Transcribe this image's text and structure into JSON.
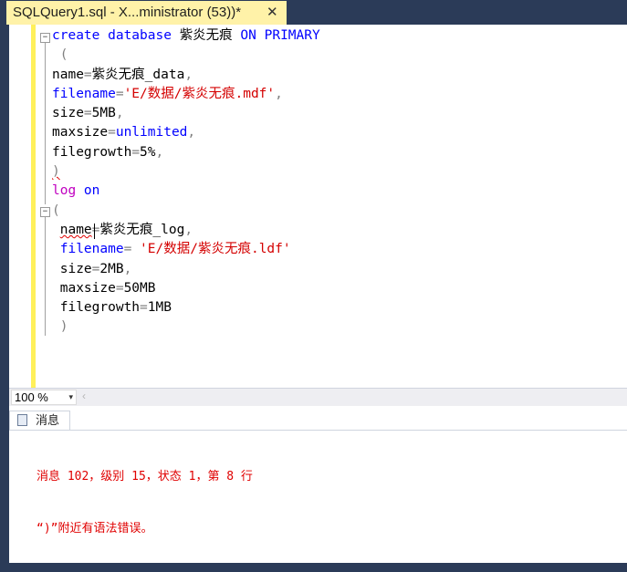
{
  "tab": {
    "title": "SQLQuery1.sql - X...ministrator (53))*",
    "close_glyph": "✕"
  },
  "editor": {
    "lines": [
      [
        {
          "t": "create database ",
          "c": "kw"
        },
        {
          "t": "紫炎无痕 ",
          "c": ""
        },
        {
          "t": "ON PRIMARY",
          "c": "kw"
        }
      ],
      [
        {
          "t": " (",
          "c": "gray"
        }
      ],
      [
        {
          "t": "name",
          "c": ""
        },
        {
          "t": "=",
          "c": "gray"
        },
        {
          "t": "紫炎无痕_data",
          "c": ""
        },
        {
          "t": ",",
          "c": "gray"
        }
      ],
      [
        {
          "t": "filename",
          "c": "kw"
        },
        {
          "t": "=",
          "c": "gray"
        },
        {
          "t": "'E/数据/紫炎无痕.mdf'",
          "c": "str"
        },
        {
          "t": ",",
          "c": "gray"
        }
      ],
      [
        {
          "t": "size",
          "c": ""
        },
        {
          "t": "=",
          "c": "gray"
        },
        {
          "t": "5MB",
          "c": ""
        },
        {
          "t": ",",
          "c": "gray"
        }
      ],
      [
        {
          "t": "maxsize",
          "c": ""
        },
        {
          "t": "=",
          "c": "gray"
        },
        {
          "t": "unlimited",
          "c": "kw"
        },
        {
          "t": ",",
          "c": "gray"
        }
      ],
      [
        {
          "t": "filegrowth",
          "c": ""
        },
        {
          "t": "=",
          "c": "gray"
        },
        {
          "t": "5%",
          "c": ""
        },
        {
          "t": ",",
          "c": "gray"
        }
      ],
      [
        {
          "t": ")",
          "c": "gray squig"
        }
      ],
      [
        {
          "t": "log ",
          "c": "mag"
        },
        {
          "t": "on",
          "c": "kw"
        }
      ],
      [
        {
          "t": "(",
          "c": "gray"
        }
      ],
      [
        {
          "t": " ",
          "c": ""
        },
        {
          "t": "name",
          "c": "squig"
        },
        {
          "t": "=",
          "c": "gray"
        },
        {
          "t": "紫炎无痕_log",
          "c": ""
        },
        {
          "t": ",",
          "c": "gray"
        }
      ],
      [
        {
          "t": " filename",
          "c": "kw"
        },
        {
          "t": "= ",
          "c": "gray"
        },
        {
          "t": "'E/数据/紫炎无痕.ldf'",
          "c": "str"
        }
      ],
      [
        {
          "t": " size",
          "c": ""
        },
        {
          "t": "=",
          "c": "gray"
        },
        {
          "t": "2MB",
          "c": ""
        },
        {
          "t": ",",
          "c": "gray"
        }
      ],
      [
        {
          "t": " maxsize",
          "c": ""
        },
        {
          "t": "=",
          "c": "gray"
        },
        {
          "t": "50MB",
          "c": ""
        }
      ],
      [
        {
          "t": " filegrowth",
          "c": ""
        },
        {
          "t": "=",
          "c": "gray"
        },
        {
          "t": "1MB",
          "c": ""
        }
      ],
      [
        {
          "t": " )",
          "c": "gray"
        }
      ]
    ]
  },
  "status": {
    "zoom": "100 %",
    "zoom_arrow": "▾",
    "scroll_left": "‹"
  },
  "results": {
    "tab_label": "消息",
    "messages": [
      "消息 102，级别 15，状态 1，第 8 行",
      "“)”附近有语法错误。"
    ]
  },
  "colors": {
    "keyword": "#0000ff",
    "string": "#d40000",
    "error": "#e00000",
    "tab_active": "#fff2a8",
    "chrome": "#2b3b58"
  }
}
